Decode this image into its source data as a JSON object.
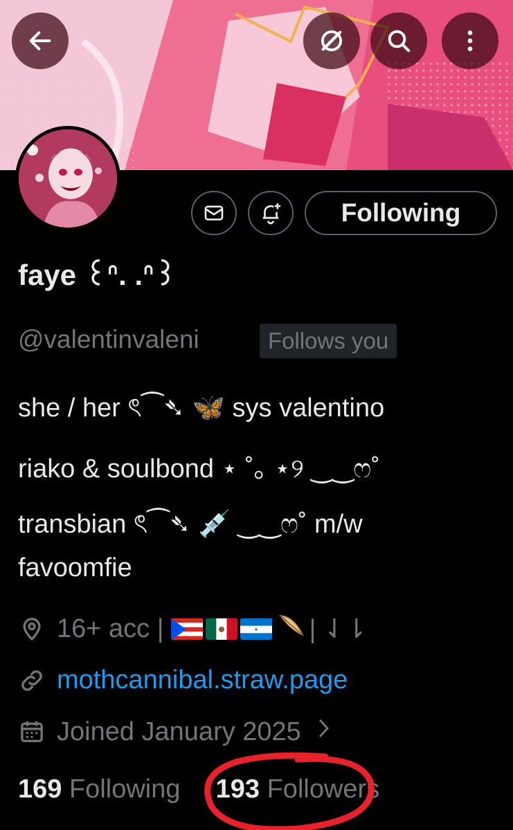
{
  "header": {
    "back_icon": "arrow-left-icon",
    "grok_icon": "slash-circle-icon",
    "search_icon": "search-icon",
    "more_icon": "more-vertical-icon"
  },
  "actions": {
    "message_icon": "envelope-icon",
    "notify_icon": "bell-plus-icon",
    "following_label": "Following"
  },
  "profile": {
    "display_name": "faye ꒰ᐢ. .ᐢ꒱",
    "handle": "@valentinvaleni",
    "follows_you": "Follows you",
    "bio": [
      "she / her ৎ⁀➴ 🦋 sys valentino",
      "riako & soulbond ⋆ ˚｡ ⋆୨ ‿‿ෆ˚",
      "transbian ৎ⁀➴ 💉 ‿‿ෆ˚ m/w",
      "favoomfie"
    ],
    "location": "16+ acc |",
    "location_suffix": "| ⇃⇂",
    "link": "mothcannibal.straw.page",
    "joined": "Joined January 2025",
    "following_count": "169",
    "following_label": "Following",
    "followers_count": "193",
    "followers_label": "Followers"
  },
  "colors": {
    "accent_link": "#1d9bf0",
    "muted": "#71767b",
    "text": "#e7e9ea",
    "annotation_red": "#e8222b"
  }
}
